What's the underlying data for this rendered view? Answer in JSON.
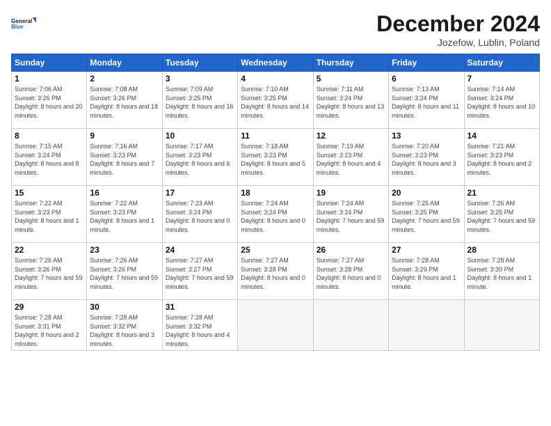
{
  "header": {
    "logo_line1": "General",
    "logo_line2": "Blue",
    "title": "December 2024",
    "location": "Jozefow, Lublin, Poland"
  },
  "weekdays": [
    "Sunday",
    "Monday",
    "Tuesday",
    "Wednesday",
    "Thursday",
    "Friday",
    "Saturday"
  ],
  "weeks": [
    [
      {
        "day": "1",
        "rise": "Sunrise: 7:06 AM",
        "set": "Sunset: 3:26 PM",
        "light": "Daylight: 8 hours and 20 minutes."
      },
      {
        "day": "2",
        "rise": "Sunrise: 7:08 AM",
        "set": "Sunset: 3:26 PM",
        "light": "Daylight: 8 hours and 18 minutes."
      },
      {
        "day": "3",
        "rise": "Sunrise: 7:09 AM",
        "set": "Sunset: 3:25 PM",
        "light": "Daylight: 8 hours and 16 minutes."
      },
      {
        "day": "4",
        "rise": "Sunrise: 7:10 AM",
        "set": "Sunset: 3:25 PM",
        "light": "Daylight: 8 hours and 14 minutes."
      },
      {
        "day": "5",
        "rise": "Sunrise: 7:11 AM",
        "set": "Sunset: 3:24 PM",
        "light": "Daylight: 8 hours and 13 minutes."
      },
      {
        "day": "6",
        "rise": "Sunrise: 7:13 AM",
        "set": "Sunset: 3:24 PM",
        "light": "Daylight: 8 hours and 11 minutes."
      },
      {
        "day": "7",
        "rise": "Sunrise: 7:14 AM",
        "set": "Sunset: 3:24 PM",
        "light": "Daylight: 8 hours and 10 minutes."
      }
    ],
    [
      {
        "day": "8",
        "rise": "Sunrise: 7:15 AM",
        "set": "Sunset: 3:24 PM",
        "light": "Daylight: 8 hours and 8 minutes."
      },
      {
        "day": "9",
        "rise": "Sunrise: 7:16 AM",
        "set": "Sunset: 3:23 PM",
        "light": "Daylight: 8 hours and 7 minutes."
      },
      {
        "day": "10",
        "rise": "Sunrise: 7:17 AM",
        "set": "Sunset: 3:23 PM",
        "light": "Daylight: 8 hours and 6 minutes."
      },
      {
        "day": "11",
        "rise": "Sunrise: 7:18 AM",
        "set": "Sunset: 3:23 PM",
        "light": "Daylight: 8 hours and 5 minutes."
      },
      {
        "day": "12",
        "rise": "Sunrise: 7:19 AM",
        "set": "Sunset: 3:23 PM",
        "light": "Daylight: 8 hours and 4 minutes."
      },
      {
        "day": "13",
        "rise": "Sunrise: 7:20 AM",
        "set": "Sunset: 3:23 PM",
        "light": "Daylight: 8 hours and 3 minutes."
      },
      {
        "day": "14",
        "rise": "Sunrise: 7:21 AM",
        "set": "Sunset: 3:23 PM",
        "light": "Daylight: 8 hours and 2 minutes."
      }
    ],
    [
      {
        "day": "15",
        "rise": "Sunrise: 7:22 AM",
        "set": "Sunset: 3:23 PM",
        "light": "Daylight: 8 hours and 1 minute."
      },
      {
        "day": "16",
        "rise": "Sunrise: 7:22 AM",
        "set": "Sunset: 3:23 PM",
        "light": "Daylight: 8 hours and 1 minute."
      },
      {
        "day": "17",
        "rise": "Sunrise: 7:23 AM",
        "set": "Sunset: 3:24 PM",
        "light": "Daylight: 8 hours and 0 minutes."
      },
      {
        "day": "18",
        "rise": "Sunrise: 7:24 AM",
        "set": "Sunset: 3:24 PM",
        "light": "Daylight: 8 hours and 0 minutes."
      },
      {
        "day": "19",
        "rise": "Sunrise: 7:24 AM",
        "set": "Sunset: 3:24 PM",
        "light": "Daylight: 7 hours and 59 minutes."
      },
      {
        "day": "20",
        "rise": "Sunrise: 7:25 AM",
        "set": "Sunset: 3:25 PM",
        "light": "Daylight: 7 hours and 59 minutes."
      },
      {
        "day": "21",
        "rise": "Sunrise: 7:26 AM",
        "set": "Sunset: 3:25 PM",
        "light": "Daylight: 7 hours and 59 minutes."
      }
    ],
    [
      {
        "day": "22",
        "rise": "Sunrise: 7:26 AM",
        "set": "Sunset: 3:26 PM",
        "light": "Daylight: 7 hours and 59 minutes."
      },
      {
        "day": "23",
        "rise": "Sunrise: 7:26 AM",
        "set": "Sunset: 3:26 PM",
        "light": "Daylight: 7 hours and 59 minutes."
      },
      {
        "day": "24",
        "rise": "Sunrise: 7:27 AM",
        "set": "Sunset: 3:27 PM",
        "light": "Daylight: 7 hours and 59 minutes."
      },
      {
        "day": "25",
        "rise": "Sunrise: 7:27 AM",
        "set": "Sunset: 3:28 PM",
        "light": "Daylight: 8 hours and 0 minutes."
      },
      {
        "day": "26",
        "rise": "Sunrise: 7:27 AM",
        "set": "Sunset: 3:28 PM",
        "light": "Daylight: 8 hours and 0 minutes."
      },
      {
        "day": "27",
        "rise": "Sunrise: 7:28 AM",
        "set": "Sunset: 3:29 PM",
        "light": "Daylight: 8 hours and 1 minute."
      },
      {
        "day": "28",
        "rise": "Sunrise: 7:28 AM",
        "set": "Sunset: 3:30 PM",
        "light": "Daylight: 8 hours and 1 minute."
      }
    ],
    [
      {
        "day": "29",
        "rise": "Sunrise: 7:28 AM",
        "set": "Sunset: 3:31 PM",
        "light": "Daylight: 8 hours and 2 minutes."
      },
      {
        "day": "30",
        "rise": "Sunrise: 7:28 AM",
        "set": "Sunset: 3:32 PM",
        "light": "Daylight: 8 hours and 3 minutes."
      },
      {
        "day": "31",
        "rise": "Sunrise: 7:28 AM",
        "set": "Sunset: 3:32 PM",
        "light": "Daylight: 8 hours and 4 minutes."
      },
      null,
      null,
      null,
      null
    ]
  ]
}
